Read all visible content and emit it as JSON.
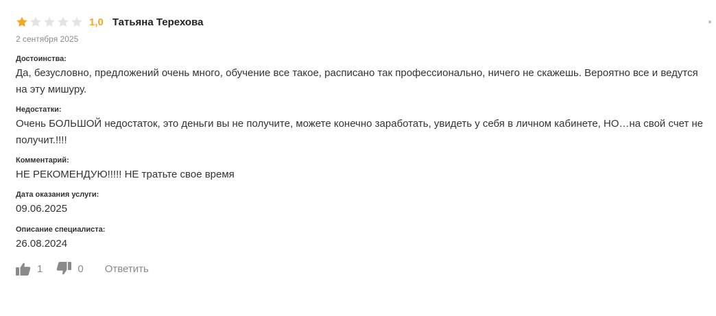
{
  "review": {
    "rating": {
      "value_text": "1,0",
      "value": 1,
      "max": 5,
      "filled_color": "#f5a623",
      "empty_color": "#e3e3e3"
    },
    "author": "Татьяна Терехова",
    "date": "2 сентября 2025",
    "sections": {
      "pros": {
        "title": "Достоинства:",
        "text": "Да, безусловно, предложений очень много, обучение все такое, расписано так профессионально, ничего не скажешь. Вероятно все и ведутся на эту мишуру."
      },
      "cons": {
        "title": "Недостатки:",
        "text": "Очень БОЛЬШОЙ недостаток, это деньги вы не получите, можете конечно заработать, увидеть у себя в личном кабинете, НО…на свой счет не получит.!!!!"
      },
      "comment": {
        "title": "Комментарий:",
        "text": "НЕ РЕКОМЕНДУЮ!!!!! НЕ тратьте свое время"
      },
      "service_date": {
        "title": "Дата оказания услуги:",
        "text": "09.06.2025"
      },
      "specialist_description": {
        "title": "Описание специалиста:",
        "text": "26.08.2024"
      }
    },
    "actions": {
      "like_icon": "thumbs-up-icon",
      "like_count": "1",
      "dislike_icon": "thumbs-down-icon",
      "dislike_count": "0",
      "reply_label": "Ответить",
      "icon_color": "#8a8a8a"
    },
    "menu_icon": "menu-dot-icon"
  }
}
